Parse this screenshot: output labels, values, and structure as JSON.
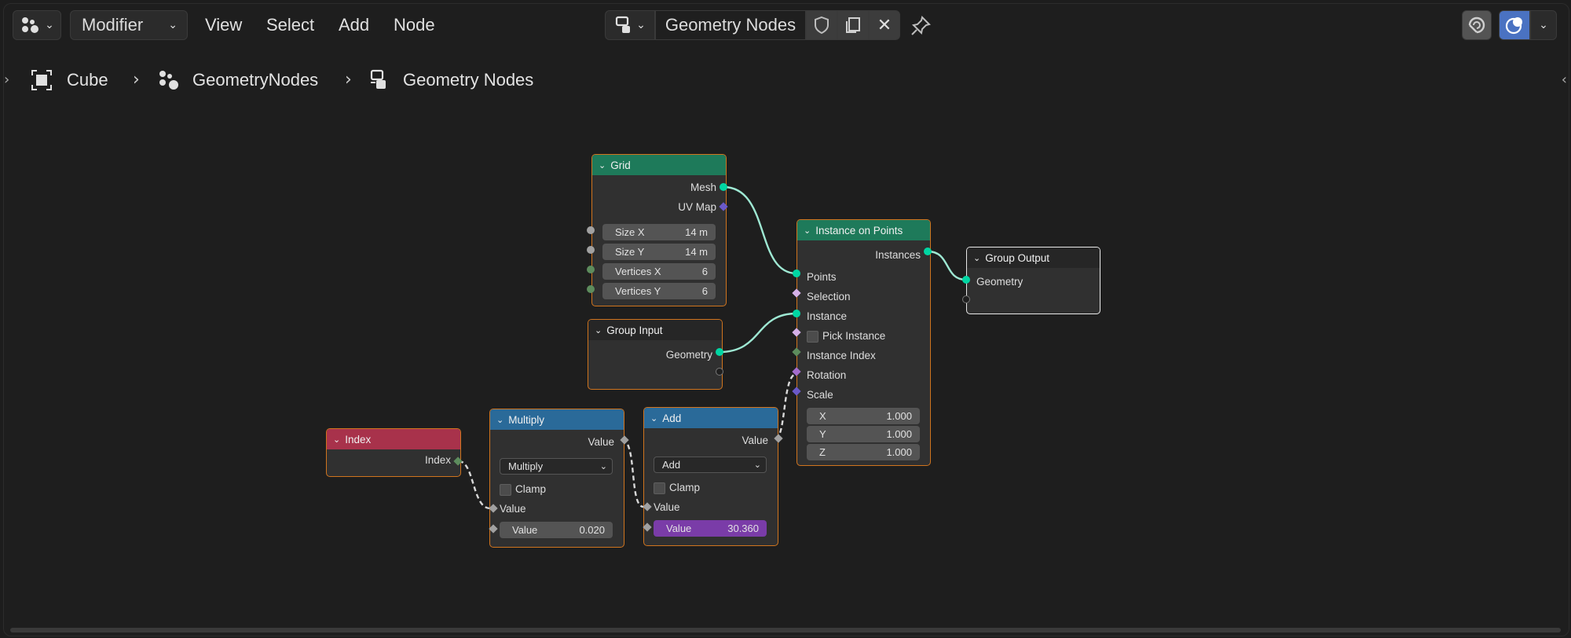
{
  "header": {
    "editor_type_icon": "geometry-nodes-icon",
    "context_label": "Modifier",
    "menus": [
      "View",
      "Select",
      "Add",
      "Node"
    ],
    "tree_name": "Geometry Nodes",
    "icons": [
      "fake-user-shield-icon",
      "duplicate-icon",
      "close-icon",
      "pin-icon",
      "overlay-icon",
      "gizmo-icon",
      "chevron-down-icon"
    ]
  },
  "breadcrumb": {
    "items": [
      {
        "icon": "mesh-cube-icon",
        "label": "Cube"
      },
      {
        "icon": "geometry-nodes-modifier-icon",
        "label": "GeometryNodes"
      },
      {
        "icon": "node-tree-icon",
        "label": "Geometry Nodes"
      }
    ]
  },
  "colors": {
    "geometry_socket": "#00d6a3",
    "vector_socket": "#6b59c9",
    "float_socket": "#a1a1a1",
    "int_socket": "#5d8c5d",
    "node_select_border": "#d0741e",
    "header_geometry": "#1e7a5a",
    "header_group": "#262626",
    "header_math": "#2a6a99",
    "header_input": "#a8324b",
    "value_highlight": "#7a3ca8"
  },
  "nodes": {
    "grid": {
      "title": "Grid",
      "out_mesh": "Mesh",
      "out_uvmap": "UV Map",
      "size_x_label": "Size X",
      "size_x_value": "14 m",
      "size_y_label": "Size Y",
      "size_y_value": "14 m",
      "vert_x_label": "Vertices X",
      "vert_x_value": "6",
      "vert_y_label": "Vertices Y",
      "vert_y_value": "6"
    },
    "group_input": {
      "title": "Group Input",
      "out_geometry": "Geometry"
    },
    "instance_on_points": {
      "title": "Instance on Points",
      "out_instances": "Instances",
      "in_points": "Points",
      "in_selection": "Selection",
      "in_instance": "Instance",
      "in_pick_instance": "Pick Instance",
      "in_instance_index": "Instance Index",
      "in_rotation": "Rotation",
      "in_scale": "Scale",
      "scale_x_label": "X",
      "scale_x_value": "1.000",
      "scale_y_label": "Y",
      "scale_y_value": "1.000",
      "scale_z_label": "Z",
      "scale_z_value": "1.000"
    },
    "group_output": {
      "title": "Group Output",
      "in_geometry": "Geometry"
    },
    "index": {
      "title": "Index",
      "out_index": "Index"
    },
    "multiply": {
      "title": "Multiply",
      "out_value": "Value",
      "operation": "Multiply",
      "clamp_label": "Clamp",
      "in_value_label": "Value",
      "value2_label": "Value",
      "value2": "0.020"
    },
    "add": {
      "title": "Add",
      "out_value": "Value",
      "operation": "Add",
      "clamp_label": "Clamp",
      "in_value_label": "Value",
      "value2_label": "Value",
      "value2": "30.360"
    }
  }
}
